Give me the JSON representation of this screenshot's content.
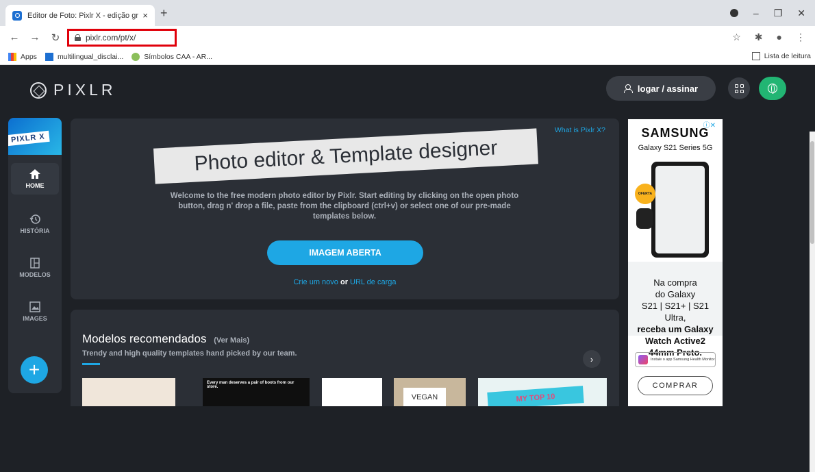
{
  "browser": {
    "tab_title": "Editor de Foto: Pixlr X - edição gr",
    "tab_close": "×",
    "new_tab": "+",
    "url": "pixlr.com/pt/x/",
    "bookmarks": [
      {
        "label": "Apps",
        "icon": "apps-grid-icon"
      },
      {
        "label": "multilingual_disclai...",
        "icon": "bookmark-favicon-icon"
      },
      {
        "label": "Símbolos CAA - AR...",
        "icon": "bookmark-favicon-icon"
      }
    ],
    "reading_list": "Lista de leitura"
  },
  "header": {
    "logo_text": "PIXLR",
    "login_label": "logar / assinar"
  },
  "sidebar": {
    "badge": "PIXLR X",
    "items": [
      {
        "label": "HOME",
        "icon": "home-icon"
      },
      {
        "label": "HISTÓRIA",
        "icon": "history-icon"
      },
      {
        "label": "MODELOS",
        "icon": "templates-icon"
      },
      {
        "label": "IMAGES",
        "icon": "image-icon"
      }
    ]
  },
  "hero": {
    "what_is": "What is Pixlr X?",
    "title": "Photo editor & Template designer",
    "welcome": "Welcome to the free modern photo editor by Pixlr. Start editing by clicking on the open photo button, drag n' drop a file, paste from the clipboard (ctrl+v) or select one of our pre-made templates below.",
    "open_button": "IMAGEM ABERTA",
    "create_new": "Crie um novo",
    "or": "or",
    "url_load": "URL de carga"
  },
  "models": {
    "title": "Modelos recomendados",
    "see_more": "(Ver Mais)",
    "subtitle": "Trendy and high quality templates hand picked by our team.",
    "thumb2_text": "Every man deserves a pair of boots from our store.",
    "thumb4_text": "VEGAN",
    "thumb5_text": "MY TOP 10"
  },
  "ad": {
    "brand": "SAMSUNG",
    "model": "Galaxy S21 Series 5G",
    "badge": "OFERTA",
    "line1": "Na compra",
    "line2": "do Galaxy",
    "line3": "S21 | S21+ | S21 Ultra,",
    "bold1": "receba um Galaxy",
    "bold2": "Watch Active2",
    "bold3": "44mm Preto.",
    "health": "Instale o app Samsung Health Monitor",
    "cta": "COMPRAR"
  },
  "colors": {
    "accent": "#1ea7e4",
    "green": "#22b573",
    "bg": "#1e2126",
    "panel": "#2b2f36",
    "highlight": "#e0000a"
  }
}
